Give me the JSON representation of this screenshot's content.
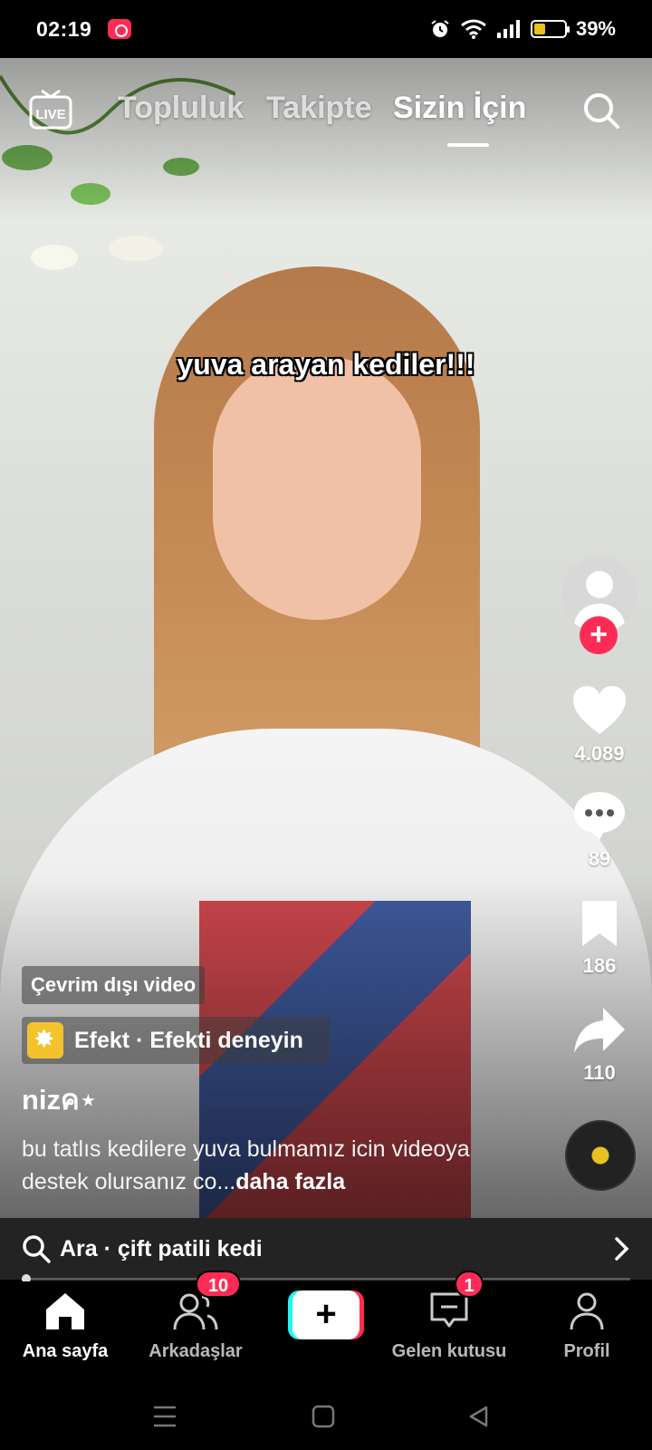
{
  "status_bar": {
    "time": "02:19",
    "battery_percent": "39%",
    "battery_level": 0.39,
    "icons": [
      "screen-record-icon",
      "alarm-icon",
      "wifi-icon",
      "signal-icon",
      "battery-icon"
    ]
  },
  "top_nav": {
    "live_label": "LIVE",
    "tabs": [
      {
        "label": "Topluluk"
      },
      {
        "label": "Takipte"
      },
      {
        "label": "Sizin İçin",
        "active": true
      }
    ]
  },
  "video": {
    "caption_overlay": "yuva arayan kediler!!!"
  },
  "rail": {
    "likes": "4.089",
    "comments": "89",
    "saves": "186",
    "shares": "110"
  },
  "info": {
    "offline_label": "Çevrim dışı video",
    "effect_label": "Efekt · Efekti deneyin",
    "username": "nizค⋆",
    "description": "bu tatlıs kedilere yuva bulmamız icin videoya destek olursanız co...",
    "more_label": "daha fazla"
  },
  "search_suggestion": {
    "label": "Ara · çift patili kedi"
  },
  "playback": {
    "progress": 0.01
  },
  "bottom_nav": {
    "items": [
      {
        "label": "Ana sayfa",
        "active": true
      },
      {
        "label": "Arkadaşlar",
        "badge": "10"
      },
      {
        "label": ""
      },
      {
        "label": "Gelen kutusu",
        "badge": "1"
      },
      {
        "label": "Profil"
      }
    ]
  },
  "colors": {
    "accent": "#fe2c55",
    "cyan": "#25f4ee",
    "effect_yellow": "#f4c32c"
  }
}
